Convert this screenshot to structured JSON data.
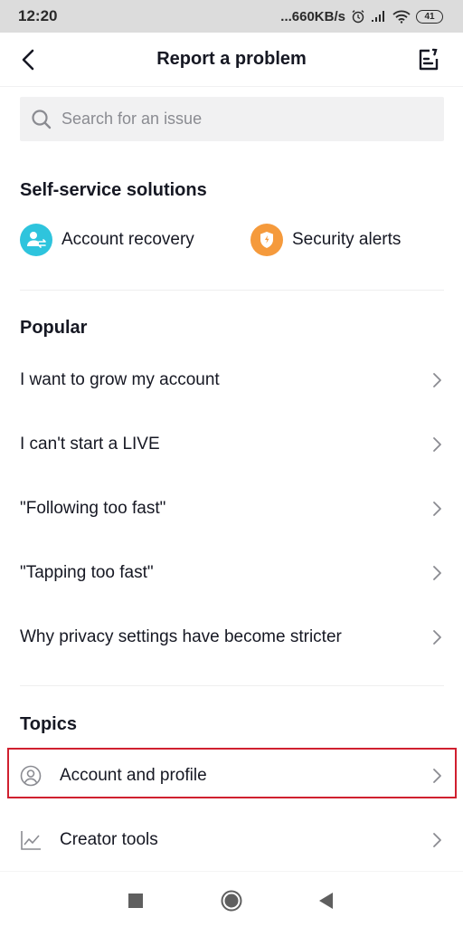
{
  "status_bar": {
    "time": "12:20",
    "network_speed": "...660KB/s",
    "battery_level": "41",
    "icons": [
      "alarm-icon",
      "signal-icon",
      "wifi-icon",
      "battery-icon"
    ]
  },
  "header": {
    "title": "Report a problem",
    "back_icon": "chevron-left-icon",
    "action_icon": "edit-note-icon"
  },
  "search": {
    "placeholder": "Search for an issue",
    "value": ""
  },
  "self_service": {
    "title": "Self-service solutions",
    "items": [
      {
        "label": "Account recovery",
        "icon": "account-recovery-icon",
        "color": "#2ec4dd"
      },
      {
        "label": "Security alerts",
        "icon": "shield-icon",
        "color": "#f59a3c"
      }
    ]
  },
  "popular": {
    "title": "Popular",
    "items": [
      {
        "label": "I want to grow my account"
      },
      {
        "label": "I can't start a LIVE"
      },
      {
        "label": "\"Following too fast\""
      },
      {
        "label": "\"Tapping too fast\""
      },
      {
        "label": "Why privacy settings have become stricter"
      }
    ]
  },
  "topics": {
    "title": "Topics",
    "items": [
      {
        "label": "Account and profile",
        "icon": "user-circle-icon",
        "highlighted": true
      },
      {
        "label": "Creator tools",
        "icon": "line-chart-icon",
        "highlighted": false
      }
    ],
    "highlight_color": "#d0202f"
  },
  "system_nav": {
    "buttons": [
      "recents",
      "home",
      "back"
    ]
  }
}
